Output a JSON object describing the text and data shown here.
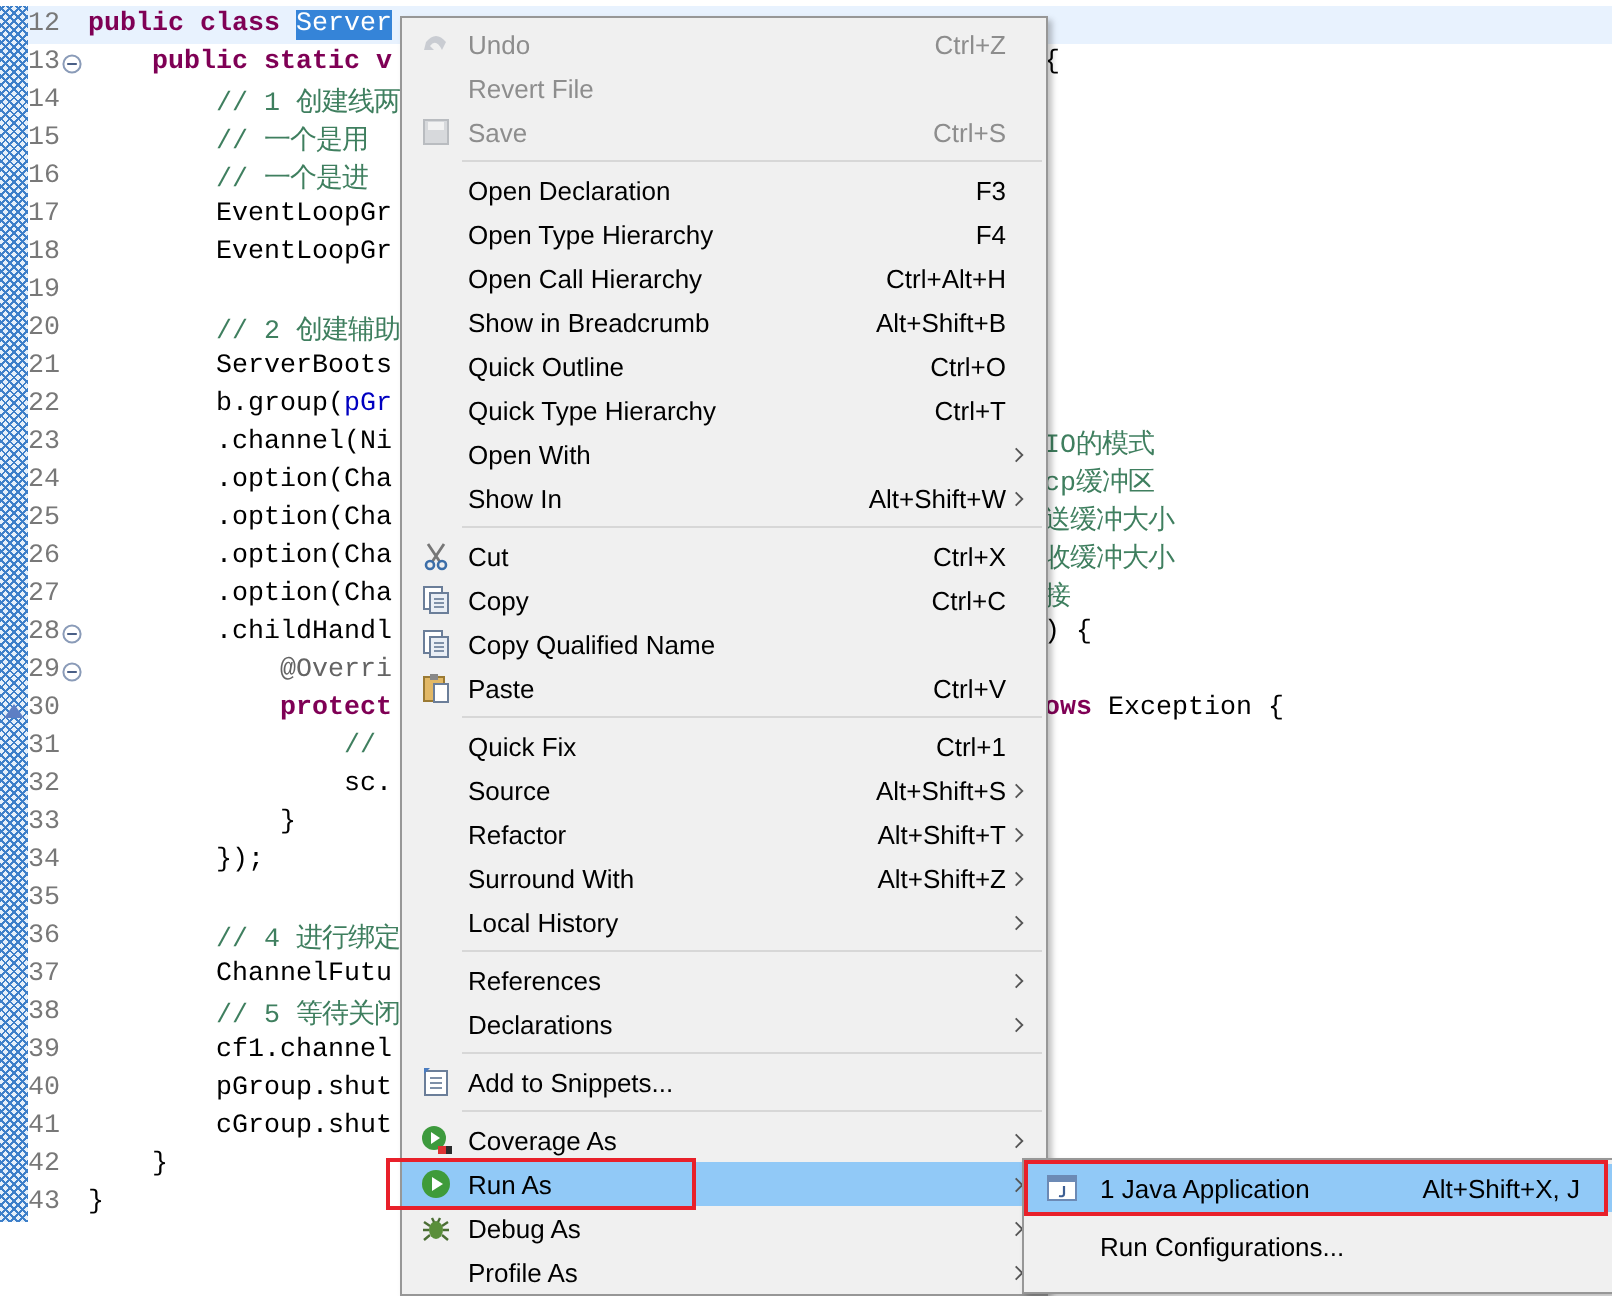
{
  "editor": {
    "lines": [
      {
        "number": "12",
        "current": true,
        "left": [
          {
            "text": "public class ",
            "kind": "keyword"
          },
          {
            "text": "Server",
            "kind": "selected"
          }
        ]
      },
      {
        "number": "13",
        "current": false,
        "marker": {
          "kind": "fold"
        },
        "left": [
          {
            "text": "    public static v",
            "kind": "keyword"
          }
        ],
        "right": [
          {
            "text": "{",
            "kind": "plain"
          }
        ]
      },
      {
        "number": "14",
        "current": false,
        "left": [
          {
            "text": "        // 1 创建线两",
            "kind": "comment"
          }
        ]
      },
      {
        "number": "15",
        "current": false,
        "left": [
          {
            "text": "        // 一个是用",
            "kind": "comment"
          }
        ]
      },
      {
        "number": "16",
        "current": false,
        "left": [
          {
            "text": "        // 一个是进",
            "kind": "comment"
          }
        ]
      },
      {
        "number": "17",
        "current": false,
        "left": [
          {
            "text": "        EventLoopGr",
            "kind": "plain"
          }
        ]
      },
      {
        "number": "18",
        "current": false,
        "left": [
          {
            "text": "        EventLoopGr",
            "kind": "plain"
          }
        ]
      },
      {
        "number": "19",
        "current": false
      },
      {
        "number": "20",
        "current": false,
        "left": [
          {
            "text": "        // 2 创建辅助",
            "kind": "comment"
          }
        ]
      },
      {
        "number": "21",
        "current": false,
        "left": [
          {
            "text": "        ServerBoots",
            "kind": "plain"
          }
        ]
      },
      {
        "number": "22",
        "current": false,
        "left": [
          {
            "text": "        b.group(",
            "kind": "plain"
          },
          {
            "text": "pGr",
            "kind": "field"
          }
        ]
      },
      {
        "number": "23",
        "current": false,
        "left": [
          {
            "text": "        .channel(Ni",
            "kind": "plain"
          }
        ],
        "right": [
          {
            "text": "IO的模式",
            "kind": "comment"
          }
        ]
      },
      {
        "number": "24",
        "current": false,
        "left": [
          {
            "text": "        .option(Cha",
            "kind": "plain"
          }
        ],
        "right": [
          {
            "text": "cp缓冲区",
            "kind": "comment"
          }
        ]
      },
      {
        "number": "25",
        "current": false,
        "left": [
          {
            "text": "        .option(Cha",
            "kind": "plain"
          }
        ],
        "right": [
          {
            "text": "送缓冲大小",
            "kind": "comment"
          }
        ]
      },
      {
        "number": "26",
        "current": false,
        "left": [
          {
            "text": "        .option(Cha",
            "kind": "plain"
          }
        ],
        "right": [
          {
            "text": "收缓冲大小",
            "kind": "comment"
          }
        ]
      },
      {
        "number": "27",
        "current": false,
        "left": [
          {
            "text": "        .option(Cha",
            "kind": "plain"
          }
        ],
        "right": [
          {
            "text": "接",
            "kind": "comment"
          }
        ]
      },
      {
        "number": "28",
        "current": false,
        "marker": {
          "kind": "fold"
        },
        "left": [
          {
            "text": "        .childHandl",
            "kind": "plain"
          }
        ],
        "right": [
          {
            "text": ") {",
            "kind": "plain"
          }
        ]
      },
      {
        "number": "29",
        "current": false,
        "marker": {
          "kind": "fold"
        },
        "left": [
          {
            "text": "            @Overri",
            "kind": "annotation"
          }
        ]
      },
      {
        "number": "30",
        "current": false,
        "marker": {
          "kind": "override"
        },
        "left": [
          {
            "text": "            protect",
            "kind": "keyword"
          }
        ],
        "right": [
          {
            "text": "ows",
            "kind": "keyword"
          },
          {
            "text": " Exception {",
            "kind": "plain"
          }
        ]
      },
      {
        "number": "31",
        "current": false,
        "left": [
          {
            "text": "                //",
            "kind": "comment"
          }
        ]
      },
      {
        "number": "32",
        "current": false,
        "left": [
          {
            "text": "                sc.",
            "kind": "plain"
          }
        ]
      },
      {
        "number": "33",
        "current": false,
        "left": [
          {
            "text": "            }",
            "kind": "plain"
          }
        ]
      },
      {
        "number": "34",
        "current": false,
        "left": [
          {
            "text": "        });",
            "kind": "plain"
          }
        ]
      },
      {
        "number": "35",
        "current": false
      },
      {
        "number": "36",
        "current": false,
        "left": [
          {
            "text": "        // 4 进行绑定",
            "kind": "comment"
          }
        ]
      },
      {
        "number": "37",
        "current": false,
        "left": [
          {
            "text": "        ChannelFutu",
            "kind": "plain"
          }
        ]
      },
      {
        "number": "38",
        "current": false,
        "left": [
          {
            "text": "        // 5 等待关闭",
            "kind": "comment"
          }
        ]
      },
      {
        "number": "39",
        "current": false,
        "left": [
          {
            "text": "        cf1.channel",
            "kind": "plain"
          }
        ]
      },
      {
        "number": "40",
        "current": false,
        "left": [
          {
            "text": "        pGroup.shut",
            "kind": "plain"
          }
        ]
      },
      {
        "number": "41",
        "current": false,
        "left": [
          {
            "text": "        cGroup.shut",
            "kind": "plain"
          }
        ]
      },
      {
        "number": "42",
        "current": false,
        "left": [
          {
            "text": "    }",
            "kind": "plain"
          }
        ]
      },
      {
        "number": "43",
        "current": false,
        "left": [
          {
            "text": "}",
            "kind": "plain"
          }
        ]
      }
    ]
  },
  "context_menu": {
    "items": [
      {
        "kind": "item",
        "label": "Undo",
        "shortcut": "Ctrl+Z",
        "submenu": false,
        "disabled": true,
        "selected": false,
        "annotated": false
      },
      {
        "kind": "item",
        "label": "Revert File",
        "submenu": false,
        "disabled": true,
        "selected": false,
        "annotated": false
      },
      {
        "kind": "item",
        "label": "Save",
        "shortcut": "Ctrl+S",
        "submenu": false,
        "disabled": true,
        "selected": false,
        "annotated": false
      },
      {
        "kind": "separator"
      },
      {
        "kind": "item",
        "label": "Open Declaration",
        "shortcut": "F3",
        "submenu": false,
        "disabled": false,
        "selected": false,
        "annotated": false
      },
      {
        "kind": "item",
        "label": "Open Type Hierarchy",
        "shortcut": "F4",
        "submenu": false,
        "disabled": false,
        "selected": false,
        "annotated": false
      },
      {
        "kind": "item",
        "label": "Open Call Hierarchy",
        "shortcut": "Ctrl+Alt+H",
        "submenu": false,
        "disabled": false,
        "selected": false,
        "annotated": false
      },
      {
        "kind": "item",
        "label": "Show in Breadcrumb",
        "shortcut": "Alt+Shift+B",
        "submenu": false,
        "disabled": false,
        "selected": false,
        "annotated": false
      },
      {
        "kind": "item",
        "label": "Quick Outline",
        "shortcut": "Ctrl+O",
        "submenu": false,
        "disabled": false,
        "selected": false,
        "annotated": false
      },
      {
        "kind": "item",
        "label": "Quick Type Hierarchy",
        "shortcut": "Ctrl+T",
        "submenu": false,
        "disabled": false,
        "selected": false,
        "annotated": false
      },
      {
        "kind": "item",
        "label": "Open With",
        "submenu": true,
        "disabled": false,
        "selected": false,
        "annotated": false
      },
      {
        "kind": "item",
        "label": "Show In",
        "shortcut": "Alt+Shift+W",
        "submenu": true,
        "disabled": false,
        "selected": false,
        "annotated": false
      },
      {
        "kind": "separator"
      },
      {
        "kind": "item",
        "label": "Cut",
        "shortcut": "Ctrl+X",
        "submenu": false,
        "disabled": false,
        "selected": false,
        "annotated": false
      },
      {
        "kind": "item",
        "label": "Copy",
        "shortcut": "Ctrl+C",
        "submenu": false,
        "disabled": false,
        "selected": false,
        "annotated": false
      },
      {
        "kind": "item",
        "label": "Copy Qualified Name",
        "submenu": false,
        "disabled": false,
        "selected": false,
        "annotated": false
      },
      {
        "kind": "item",
        "label": "Paste",
        "shortcut": "Ctrl+V",
        "submenu": false,
        "disabled": false,
        "selected": false,
        "annotated": false
      },
      {
        "kind": "separator"
      },
      {
        "kind": "item",
        "label": "Quick Fix",
        "shortcut": "Ctrl+1",
        "submenu": false,
        "disabled": false,
        "selected": false,
        "annotated": false
      },
      {
        "kind": "item",
        "label": "Source",
        "shortcut": "Alt+Shift+S",
        "submenu": true,
        "disabled": false,
        "selected": false,
        "annotated": false
      },
      {
        "kind": "item",
        "label": "Refactor",
        "shortcut": "Alt+Shift+T",
        "submenu": true,
        "disabled": false,
        "selected": false,
        "annotated": false
      },
      {
        "kind": "item",
        "label": "Surround With",
        "shortcut": "Alt+Shift+Z",
        "submenu": true,
        "disabled": false,
        "selected": false,
        "annotated": false
      },
      {
        "kind": "item",
        "label": "Local History",
        "submenu": true,
        "disabled": false,
        "selected": false,
        "annotated": false
      },
      {
        "kind": "separator"
      },
      {
        "kind": "item",
        "label": "References",
        "submenu": true,
        "disabled": false,
        "selected": false,
        "annotated": false
      },
      {
        "kind": "item",
        "label": "Declarations",
        "submenu": true,
        "disabled": false,
        "selected": false,
        "annotated": false
      },
      {
        "kind": "separator"
      },
      {
        "kind": "item",
        "label": "Add to Snippets...",
        "submenu": false,
        "disabled": false,
        "selected": false,
        "annotated": false
      },
      {
        "kind": "separator"
      },
      {
        "kind": "item",
        "label": "Coverage As",
        "submenu": true,
        "disabled": false,
        "selected": false,
        "annotated": false
      },
      {
        "kind": "item",
        "label": "Run As",
        "submenu": true,
        "disabled": false,
        "selected": true,
        "annotated": true
      },
      {
        "kind": "item",
        "label": "Debug As",
        "submenu": true,
        "disabled": false,
        "selected": false,
        "annotated": false
      },
      {
        "kind": "item",
        "label": "Profile As",
        "submenu": true,
        "disabled": false,
        "selected": false,
        "annotated": false
      }
    ]
  },
  "submenu": {
    "items": [
      {
        "label": "1 Java Application",
        "shortcut": "Alt+Shift+X, J",
        "selected": true,
        "annotated": true
      },
      {
        "label": "Run Configurations...",
        "selected": false,
        "annotated": false
      }
    ]
  }
}
